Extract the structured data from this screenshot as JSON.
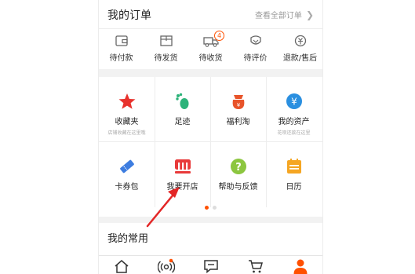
{
  "orders_section": {
    "title": "我的订单",
    "view_all": "查看全部订单",
    "items": [
      {
        "label": "待付款",
        "icon": "wallet-icon"
      },
      {
        "label": "待发货",
        "icon": "package-icon"
      },
      {
        "label": "待收货",
        "icon": "truck-icon",
        "badge": "4"
      },
      {
        "label": "待评价",
        "icon": "review-icon"
      },
      {
        "label": "退款/售后",
        "icon": "refund-icon"
      }
    ]
  },
  "tools": [
    {
      "label": "收藏夹",
      "sub": "店铺收藏在这里哦",
      "icon": "star-icon"
    },
    {
      "label": "足迹",
      "icon": "footprint-icon"
    },
    {
      "label": "福利淘",
      "icon": "gift-bag-icon"
    },
    {
      "label": "我的资产",
      "sub": "花呗还款在这里",
      "icon": "yuan-coin-icon"
    },
    {
      "label": "卡券包",
      "icon": "ticket-icon"
    },
    {
      "label": "我要开店",
      "icon": "shop-icon"
    },
    {
      "label": "帮助与反馈",
      "icon": "question-icon"
    },
    {
      "label": "日历",
      "icon": "calendar-icon"
    }
  ],
  "pager": {
    "count": 2,
    "active": 0
  },
  "common_section": {
    "title": "我的常用"
  },
  "tabbar": [
    {
      "icon": "home-icon"
    },
    {
      "icon": "broadcast-icon"
    },
    {
      "icon": "message-icon"
    },
    {
      "icon": "cart-icon"
    },
    {
      "icon": "profile-icon"
    }
  ],
  "colors": {
    "accent": "#ff5000",
    "star": "#e8322d",
    "footprint": "#2db37a",
    "gift": "#e8542a",
    "asset": "#2a8fe0",
    "ticket": "#3d7de0",
    "shop": "#e83a3a",
    "help": "#8cc63f",
    "calendar": "#f5a623",
    "annotation_arrow": "#e32626"
  }
}
